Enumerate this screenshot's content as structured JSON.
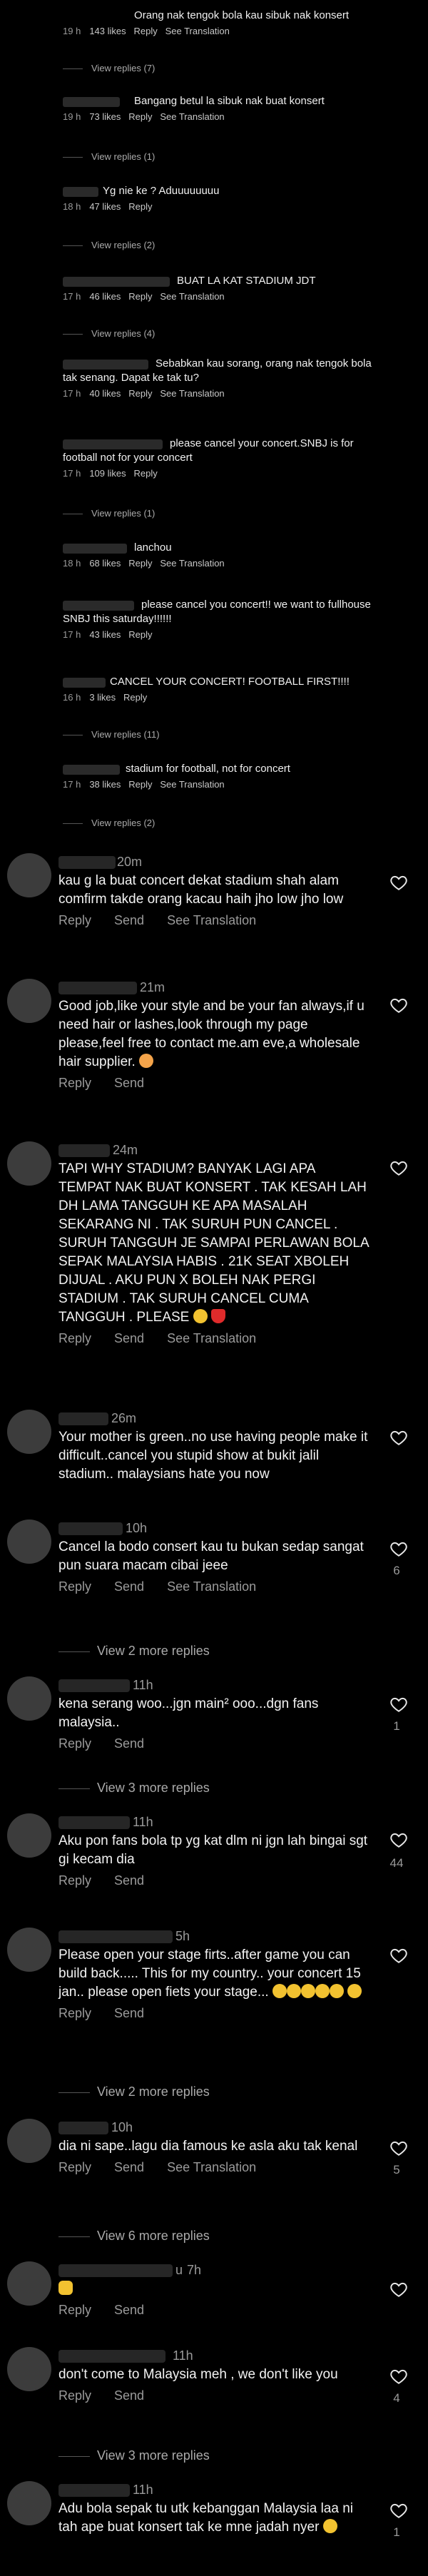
{
  "labels": {
    "reply": "Reply",
    "see_translation": "See Translation",
    "send": "Send"
  },
  "small_comments": [
    {
      "text": "Orang nak tengok bola kau sibuk nak konsert",
      "time": "19 h",
      "likes": "143 likes",
      "view_replies": "View replies (7)"
    },
    {
      "text": "Bangang betul la sibuk nak buat konsert",
      "time": "19 h",
      "likes": "73 likes",
      "view_replies": "View replies (1)"
    },
    {
      "text": "Yg nie ke ? Aduuuuuuuu",
      "time": "18 h",
      "likes": "47 likes",
      "view_replies": "View replies (2)"
    },
    {
      "text": "BUAT LA KAT STADIUM JDT",
      "time": "17 h",
      "likes": "46 likes",
      "view_replies": "View replies (4)"
    },
    {
      "text": "Sebabkan kau sorang, orang nak tengok bola tak senang. Dapat ke tak tu?",
      "time": "17 h",
      "likes": "40 likes"
    },
    {
      "text": "please cancel your concert.SNBJ is for football not for your concert",
      "time": "17 h",
      "likes": "109 likes",
      "view_replies": "View replies (1)"
    },
    {
      "text": "lanchou",
      "time": "18 h",
      "likes": "68 likes"
    },
    {
      "text": "please cancel you concert!! we want to fullhouse SNBJ this saturday!!!!!!",
      "time": "17 h",
      "likes": "43 likes"
    },
    {
      "text": "CANCEL YOUR CONCERT! FOOTBALL FIRST!!!!",
      "time": "16 h",
      "likes": "3 likes",
      "view_replies": "View replies (11)"
    },
    {
      "text": "stadium for football, not for concert",
      "time": "17 h",
      "likes": "38 likes",
      "view_replies": "View replies (2)"
    }
  ],
  "large_comments": [
    {
      "time": "20m",
      "text": "kau g la buat concert dekat stadium shah alam comfirm takde orang kacau haih jho low jho low"
    },
    {
      "time": "21m",
      "text": "Good job,like your style and be your fan always,if u need hair or lashes,look through my page please,feel free to contact me.am eve,a wholesale hair supplier."
    },
    {
      "time": "24m",
      "text": "TAPI WHY STADIUM? BANYAK LAGI APA TEMPAT NAK BUAT KONSERT . TAK KESAH LAH DH LAMA TANGGUH KE APA MASALAH SEKARANG NI . TAK SURUH PUN CANCEL . SURUH TANGGUH JE SAMPAI PERLAWAN BOLA SEPAK MALAYSIA HABIS . 21K SEAT XBOLEH DIJUAL . AKU PUN X BOLEH NAK PERGI STADIUM . TAK SURUH CANCEL CUMA TANGGUH . PLEASE"
    },
    {
      "time": "26m",
      "text": "Your mother is green..no use having people make it difficult..cancel you stupid show at bukit jalil stadium.. malaysians hate you now"
    },
    {
      "time": "10h",
      "text": "Cancel la bodo consert kau tu bukan sedap sangat pun suara macam cibai jeee",
      "count": "6",
      "view_replies": "View 2 more replies"
    },
    {
      "time": "11h",
      "text": "kena serang woo...jgn main² ooo...dgn fans malaysia..",
      "count": "1",
      "view_replies": "View 3 more replies"
    },
    {
      "time": "11h",
      "text": "Aku pon fans bola tp yg kat dlm ni jgn lah bingai sgt gi kecam dia",
      "count": "44"
    },
    {
      "time": "5h",
      "text": "Please open your stage firts..after game you can build back..... This for my country.. your concert 15 jan.. please open fiets your stage...",
      "view_replies": "View 2 more replies"
    },
    {
      "time": "10h",
      "text": "dia ni sape..lagu dia famous ke asla aku tak kenal",
      "count": "5",
      "view_replies": "View 6 more replies"
    },
    {
      "time": "7h",
      "prefix": "u",
      "text": ""
    },
    {
      "time": "11h",
      "text": "don't come to Malaysia meh , we don't like you",
      "count": "4",
      "view_replies": "View 3 more replies"
    },
    {
      "time": "11h",
      "text": "Adu bola sepak tu utk kebanggan Malaysia laa ni tah ape buat konsert tak ke mne jadah nyer",
      "count": "1"
    }
  ],
  "icons": {
    "heart": "heart-outline-icon",
    "avatar": "avatar"
  }
}
